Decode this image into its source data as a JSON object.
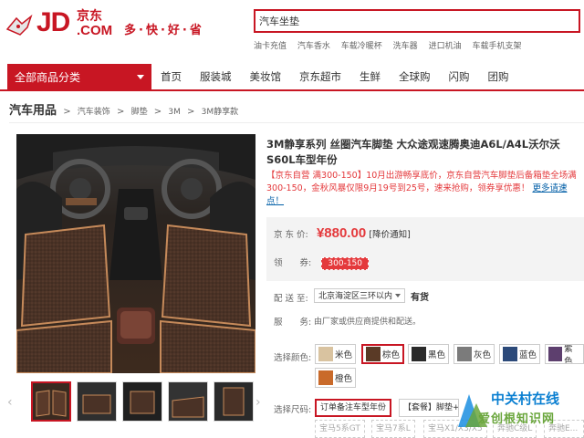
{
  "header": {
    "logo_text": "JD",
    "logo_cn": "京东",
    "logo_com": ".COM",
    "slogan": "多·快·好·省",
    "search_value": "汽车坐垫",
    "hot_words": [
      "油卡充值",
      "汽车香水",
      "车载冷暖杯",
      "洗车器",
      "进口机油",
      "车载手机支架"
    ]
  },
  "nav": {
    "category_label": "全部商品分类",
    "items": [
      "首页",
      "服装城",
      "美妆馆",
      "京东超市",
      "生鲜",
      "全球购",
      "闪购",
      "团购"
    ]
  },
  "breadcrumb": {
    "root": "汽车用品",
    "items": [
      "汽车装饰",
      "脚垫",
      "3M",
      "3M静享款"
    ]
  },
  "product": {
    "title": "3M静享系列 丝圈汽车脚垫 大众途观速腾奥迪A6L/A4L沃尔沃S60L车型年份",
    "promo_text": "【京东自营 满300-150】10月出游畅享底价，京东自营汽车脚垫后备箱垫全场满300-150，金秋风暴仅限9月19号到25号，速来抢购，领券享优惠！",
    "promo_link": "更多请速点！",
    "price_label": "京 东 价:",
    "price": "¥880.00",
    "price_notice": "[降价通知]",
    "coupon_label": "领　　券:",
    "coupon": "300-150",
    "delivery_label": "配 送 至:",
    "region": "北京海淀区三环以内",
    "stock": "有货",
    "service_label": "服　　务:",
    "service_text": "由厂家或供应商提供和配送。",
    "color_label": "选择颜色:",
    "colors": [
      {
        "name": "米色",
        "color": "#d9c3a0"
      },
      {
        "name": "棕色",
        "color": "#5a3a26"
      },
      {
        "name": "黑色",
        "color": "#2a2a2a"
      },
      {
        "name": "灰色",
        "color": "#7b7b7b"
      },
      {
        "name": "蓝色",
        "color": "#2c4a7a"
      },
      {
        "name": "紫色",
        "color": "#5d3f6e"
      },
      {
        "name": "橙色",
        "color": "#c96a2a"
      }
    ],
    "selected_color": "棕色",
    "size_label": "选择尺码:",
    "sizes_row1": [
      "订单备注车型年份",
      "【套餐】脚垫+后..."
    ],
    "sizes_row2": [
      "宝马5系GT",
      "宝马7系L",
      "宝马X1/X3/X5",
      "奔驰C级L",
      "奔驰E..."
    ]
  },
  "watermark": {
    "line1": "中关村在线",
    "line2": "爱创根知识网"
  },
  "colors": {
    "brand_red": "#c81623",
    "price_red": "#e4393c",
    "link_blue": "#005ea7"
  }
}
